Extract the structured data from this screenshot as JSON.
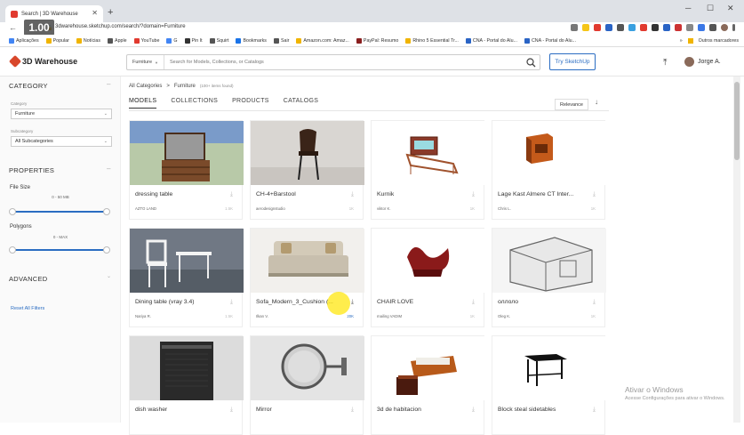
{
  "browser": {
    "tab_title": "Search | 3D Warehouse",
    "zoom_badge": "1.00",
    "url": "3dwarehouse.sketchup.com/search/?domain=Furniture",
    "bookmarks": [
      "Aplicações",
      "Popular",
      "Notícias",
      "Apple",
      "YouTube",
      "G",
      "Pin It",
      "Squirt",
      "Bookmarks",
      "Sair",
      "Amazon.com: Amaz...",
      "PayPal: Resumo",
      "Rhino 5 Essential Tr...",
      "CNA - Portal do Alu...",
      "CNA - Portal do Alu..."
    ],
    "bookmarks_more": "»",
    "other_bookmarks": "Outros marcadores"
  },
  "header": {
    "logo_text": "3D Warehouse",
    "search_category": "Furniture",
    "search_placeholder": "Search for Models, Collections, or Catalogs",
    "try_button": "Try SketchUp",
    "user_name": "Jorge A."
  },
  "sidebar": {
    "category_heading": "CATEGORY",
    "category_label": "Category",
    "category_value": "Furniture",
    "subcategory_label": "Subcategory",
    "subcategory_value": "All Subcategories",
    "properties_heading": "PROPERTIES",
    "file_size_label": "File Size",
    "file_size_range": "0 - 50 MB",
    "file_size_min": 0,
    "file_size_max": 1,
    "polygons_label": "Polygons",
    "polygons_range": "0 - MAX",
    "polygons_min": 0,
    "polygons_max": 1,
    "advanced_heading": "ADVANCED",
    "reset_label": "Reset All Filters"
  },
  "main": {
    "breadcrumb_root": "All Categories",
    "breadcrumb_sep": ">",
    "breadcrumb_current": "Furniture",
    "breadcrumb_count": "(100+ items found)",
    "tabs": [
      "MODELS",
      "COLLECTIONS",
      "PRODUCTS",
      "CATALOGS"
    ],
    "sort_label": "Relevance",
    "sort_arrow": "↓"
  },
  "models": [
    {
      "title": "dressing table",
      "author": "AZTO LAND",
      "count": "1.5K",
      "icon": "dresser"
    },
    {
      "title": "CH-4+Barstool",
      "author": "aerodesignstudio",
      "count": "1K",
      "icon": "barstool"
    },
    {
      "title": "Kurnik",
      "author": "viktor K.",
      "count": "1K",
      "icon": "chicken-coop"
    },
    {
      "title": "Lage Kast Almere CT Inter...",
      "author": "Chris L.",
      "count": "1K",
      "icon": "cabinet"
    },
    {
      "title": "Dining table (vray 3.4)",
      "author": "Nariya R.",
      "count": "1.5K",
      "icon": "dining-set"
    },
    {
      "title": "Sofa_Modern_3_Cushion (...",
      "author": "Ilkan V.",
      "count": "20K",
      "icon": "sofa"
    },
    {
      "title": "CHAIR LOVE",
      "author": "mailing VADIM",
      "count": "1K",
      "icon": "chaise"
    },
    {
      "title": "оллоло",
      "author": "Oleg K.",
      "count": "1K",
      "icon": "wireframe-room"
    },
    {
      "title": "dish washer",
      "author": "",
      "count": "",
      "icon": "dishwasher"
    },
    {
      "title": "Mirror",
      "author": "",
      "count": "",
      "icon": "mirror"
    },
    {
      "title": "3d de habitacion",
      "author": "",
      "count": "",
      "icon": "room"
    },
    {
      "title": "Block steal sidetables",
      "author": "",
      "count": "",
      "icon": "sidetable"
    }
  ],
  "watermark": {
    "line1": "Ativar o Windows",
    "line2": "Acesse Configurações para ativar o Windows."
  },
  "colors": {
    "accent": "#2b6dc2",
    "logo": "#d8472b"
  }
}
